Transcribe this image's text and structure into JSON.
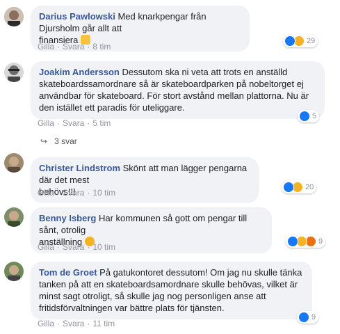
{
  "comments": [
    {
      "author": "Darius Pawlowski",
      "text": "Med knarkpengar från Djursholm går allt att finansiera",
      "line2": "finansiera",
      "like": "Gilla",
      "reply": "Svara",
      "time": "8 tim",
      "reaction_count": "29",
      "reactions": [
        "like-icon",
        "haha-icon"
      ]
    },
    {
      "author": "Joakim Andersson",
      "line1": "Dessutom ska ni veta att trots en anställd",
      "line2": "skateboardssamordnare så är skateboardparken på nobeltorget ej",
      "line3": "användbar för skateboard. För stort avstånd mellan plattorna. Nu är",
      "line4": "den istället ett paradis för uteliggare.",
      "like": "Gilla",
      "reply": "Svara",
      "time": "5 tim",
      "reaction_count": "5",
      "reactions": [
        "like-icon"
      ],
      "replies_label": "3 svar"
    },
    {
      "author": "Christer Lindstrom",
      "line1": "Skönt att man lägger pengarna där det mest",
      "line2": "behövs!!!",
      "like": "Gilla",
      "reply": "Svara",
      "time": "10 tim",
      "reaction_count": "20",
      "reactions": [
        "like-icon",
        "haha-icon"
      ]
    },
    {
      "author": "Benny Isberg",
      "line1": "Har kommunen så gott om pengar till sånt, otrolig",
      "line2": "anställning",
      "like": "Gilla",
      "reply": "Svara",
      "time": "10 tim",
      "reaction_count": "9",
      "reactions": [
        "like-icon",
        "haha-icon",
        "angry-icon"
      ]
    },
    {
      "author": "Tom de Groet",
      "line1": "På gatukontoret dessutom! Om jag nu skulle tänka",
      "line2": "tanken på att en skateboardsamordnare skulle behövas, vilket är",
      "line3": "minst sagt otroligt, så skulle jag nog personligen anse att",
      "line4": "fritidsförvaltningen var bättre plats för tjänsten.",
      "like": "Gilla",
      "reply": "Svara",
      "time": "11 tim",
      "reaction_count": "9",
      "reactions": [
        "like-icon"
      ]
    }
  ],
  "colors": {
    "author": "#385898",
    "bubble": "#f0f2f5",
    "like": "#1877f2",
    "haha": "#f7b125",
    "angry": "#e9710f"
  }
}
